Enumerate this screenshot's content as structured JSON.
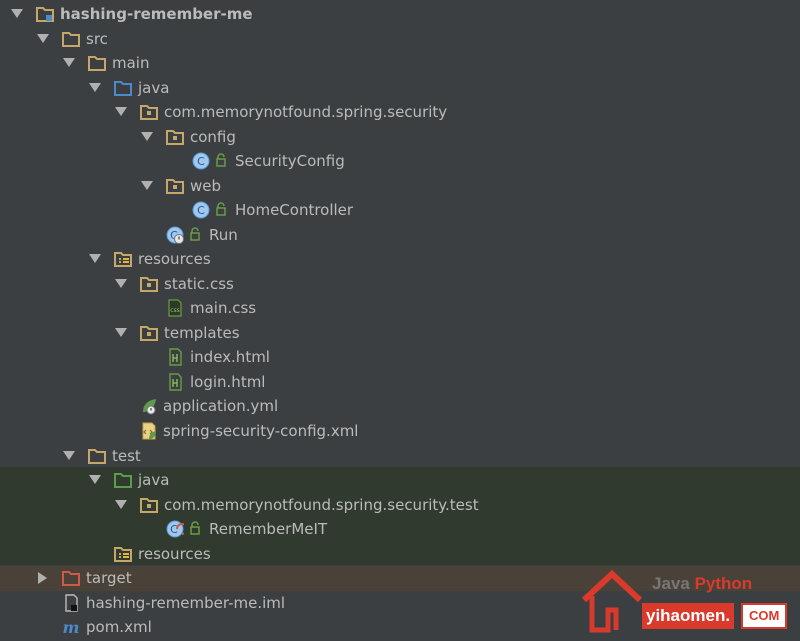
{
  "project_tree": {
    "items": [
      {
        "label": "hashing-remember-me",
        "icon": "module-folder-icon"
      },
      {
        "label": "src",
        "icon": "folder-icon"
      },
      {
        "label": "main",
        "icon": "folder-icon"
      },
      {
        "label": "java",
        "icon": "source-root-folder-icon"
      },
      {
        "label": "com.memorynotfound.spring.security",
        "icon": "package-icon"
      },
      {
        "label": "config",
        "icon": "package-icon"
      },
      {
        "label": "SecurityConfig",
        "icon": "class-icon"
      },
      {
        "label": "web",
        "icon": "package-icon"
      },
      {
        "label": "HomeController",
        "icon": "class-icon"
      },
      {
        "label": "Run",
        "icon": "spring-boot-class-icon"
      },
      {
        "label": "resources",
        "icon": "resources-folder-icon"
      },
      {
        "label": "static.css",
        "icon": "package-icon"
      },
      {
        "label": "main.css",
        "icon": "css-file-icon"
      },
      {
        "label": "templates",
        "icon": "package-icon"
      },
      {
        "label": "index.html",
        "icon": "html-file-icon"
      },
      {
        "label": "login.html",
        "icon": "html-file-icon"
      },
      {
        "label": "application.yml",
        "icon": "yaml-spring-icon"
      },
      {
        "label": "spring-security-config.xml",
        "icon": "xml-spring-icon"
      },
      {
        "label": "test",
        "icon": "folder-icon"
      },
      {
        "label": "java",
        "icon": "test-root-folder-icon"
      },
      {
        "label": "com.memorynotfound.spring.security.test",
        "icon": "package-icon"
      },
      {
        "label": "RememberMeIT",
        "icon": "test-class-icon"
      },
      {
        "label": "resources",
        "icon": "test-resources-folder-icon"
      },
      {
        "label": "target",
        "icon": "excluded-folder-icon"
      },
      {
        "label": "hashing-remember-me.iml",
        "icon": "iml-file-icon"
      },
      {
        "label": "pom.xml",
        "icon": "maven-icon"
      }
    ]
  },
  "watermark": {
    "java": "Java",
    "python": "Python",
    "site": "yihaomen.",
    "tld": "COM"
  },
  "colors": {
    "background": "#3c3f41",
    "text": "#bbbbbb",
    "folder": "#c6a76a",
    "source_root": "#4d8ac9",
    "test_root": "#5d9b4d",
    "excluded": "#d05a4a",
    "class": "#5a9bd5",
    "lock": "#6a9c46",
    "watermark_red": "#d93a2b"
  }
}
